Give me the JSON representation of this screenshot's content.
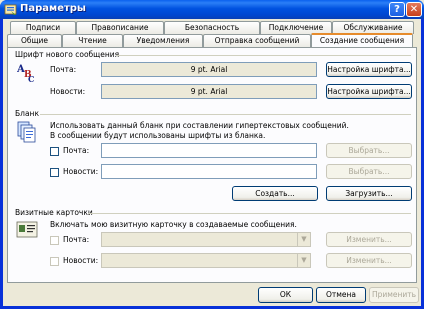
{
  "window": {
    "title": "Параметры",
    "help_label": "?",
    "close_label": "✕"
  },
  "tabs_row1": [
    "Подписи",
    "Правописание",
    "Безопасность",
    "Подключение",
    "Обслуживание"
  ],
  "tabs_row2": [
    "Общие",
    "Чтение",
    "Уведомления",
    "Отправка сообщений",
    "Создание сообщения"
  ],
  "active_tab": "Создание сообщения",
  "font_section": {
    "title": "Шрифт нового сообщения",
    "mail_label": "Почта:",
    "mail_value": "9 pt. Arial",
    "mail_button": "Настройка шрифта...",
    "news_label": "Новости:",
    "news_value": "9 pt. Arial",
    "news_button": "Настройка шрифта..."
  },
  "stationery_section": {
    "title": "Бланк",
    "description1": "Использовать данный бланк при составлении гипертекстовых сообщений.",
    "description2": "В сообщении будут использованы шрифты из бланка.",
    "mail_label": "Почта:",
    "mail_value": "",
    "mail_button": "Выбрать...",
    "news_label": "Новости:",
    "news_value": "",
    "news_button": "Выбрать...",
    "create_button": "Создать...",
    "download_button": "Загрузить..."
  },
  "vcard_section": {
    "title": "Визитные карточки",
    "description": "Включать мою визитную карточку в создаваемые сообщения.",
    "mail_label": "Почта:",
    "mail_value": "",
    "mail_button": "Изменить...",
    "news_label": "Новости:",
    "news_value": "",
    "news_button": "Изменить..."
  },
  "buttons": {
    "ok": "ОК",
    "cancel": "Отмена",
    "apply": "Применить"
  }
}
